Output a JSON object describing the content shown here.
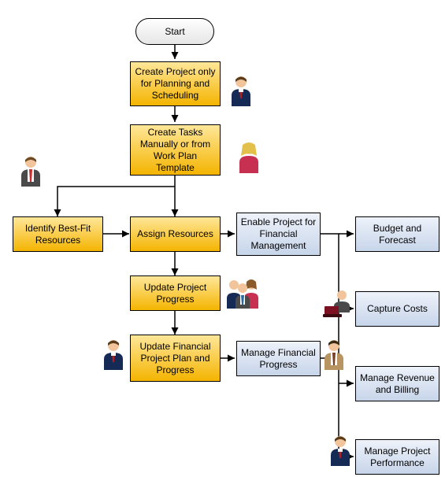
{
  "flowchart": {
    "start": "Start",
    "nodes": {
      "create_project": "Create Project only for Planning and Scheduling",
      "create_tasks": "Create Tasks Manually or from Work Plan Template",
      "identify_resources": "Identify Best-Fit Resources",
      "assign_resources": "Assign Resources",
      "enable_financial": "Enable Project for Financial Management",
      "budget_forecast": "Budget and Forecast",
      "update_progress": "Update Project Progress",
      "capture_costs": "Capture Costs",
      "update_financial_plan": "Update Financial Project Plan and Progress",
      "manage_financial_progress": "Manage Financial Progress",
      "manage_revenue": "Manage Revenue and Billing",
      "manage_performance": "Manage Project Performance"
    },
    "actors": {
      "a1": "business-man-navy",
      "a2": "business-man-red-tie",
      "a3": "business-woman-blonde",
      "a4": "team-group",
      "a5": "business-man-navy-small",
      "a6": "accountant-with-laptop",
      "a7": "business-man-tan-suit",
      "a8": "business-man-navy-bottom"
    }
  }
}
